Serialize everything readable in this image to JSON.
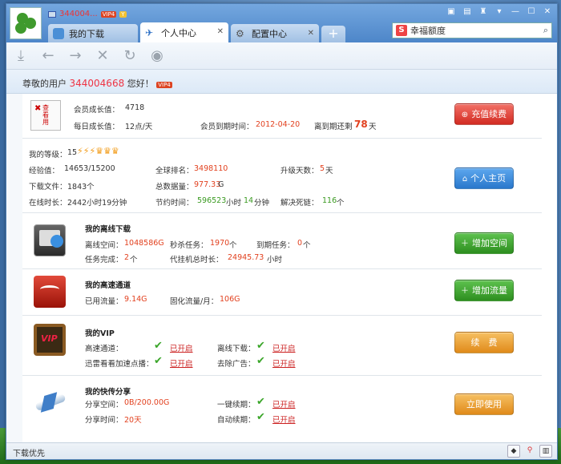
{
  "window": {
    "username": "344004...",
    "tabs": [
      {
        "label": "我的下载"
      },
      {
        "label": "个人中心"
      },
      {
        "label": "配置中心"
      }
    ],
    "search_text": "幸福额度"
  },
  "greeting": {
    "prefix": "尊敬的用户",
    "user_id": "344004668",
    "suffix": "您好！",
    "vip": "VIP4"
  },
  "growth": {
    "avatar_text": "查看用",
    "growth_label": "会员成长值：",
    "growth_value": "4718",
    "daily_label": "每日成长值：",
    "daily_value": "12点/天",
    "expire_label": "会员到期时间：",
    "expire_value": "2012-04-20",
    "remain_prefix": "离到期还剩",
    "remain_days": "78",
    "remain_suffix": "天",
    "button": "充值续费"
  },
  "stats": {
    "level_label": "我的等级：",
    "level_value": "15",
    "exp_label": "经验值：",
    "exp_value": "14653/15200",
    "rank_label": "全球排名：",
    "rank_value": "3498110",
    "upgrade_label": "升级天数：",
    "upgrade_value": "5",
    "upgrade_unit": "天",
    "files_label": "下载文件：",
    "files_value": "1843个",
    "total_label": "总数据量：",
    "total_value": "977.33",
    "total_unit": "G",
    "online_label": "在线时长：",
    "online_value": "2442小时19分钟",
    "save_label": "节约时间：",
    "save_value1": "596523",
    "save_unit1": "小时",
    "save_value2": "14",
    "save_unit2": "分钟",
    "dead_label": "解决死链：",
    "dead_value": "116",
    "dead_unit": "个",
    "button": "个人主页"
  },
  "offline": {
    "title": "我的离线下载",
    "space_label": "离线空间：",
    "space_value": "1048586G",
    "sec_label": "秒杀任务：",
    "sec_value": "1970",
    "sec_unit": "个",
    "due_label": "到期任务：",
    "due_value": "0",
    "due_unit": "个",
    "done_label": "任务完成：",
    "done_value": "2",
    "done_unit": "个",
    "agent_label": "代挂机总时长：",
    "agent_value": "24945.73",
    "agent_unit": "小时",
    "button": "增加空间"
  },
  "highspeed": {
    "title": "我的高速通道",
    "used_label": "已用流量：",
    "used_value": "9.14G",
    "fixed_label": "固化流量/月：",
    "fixed_value": "106G",
    "button": "增加流量"
  },
  "vip": {
    "badge": "VIP",
    "title": "我的VIP",
    "items": [
      {
        "label": "高速通道：",
        "status": "已开启"
      },
      {
        "label": "离线下载：",
        "status": "已开启"
      },
      {
        "label": "迅雷看看加速点播：",
        "status": "已开启"
      },
      {
        "label": "去除广告：",
        "status": "已开启"
      }
    ],
    "button": "续　费"
  },
  "share": {
    "title": "我的快传分享",
    "space_label": "分享空间：",
    "space_value": "0B/200.00G",
    "time_label": "分享时间：",
    "time_value": "20天",
    "items": [
      {
        "label": "一键续期：",
        "status": "已开启"
      },
      {
        "label": "自动续期：",
        "status": "已开启"
      }
    ],
    "button": "立即使用"
  },
  "status": {
    "text": "下载优先"
  }
}
